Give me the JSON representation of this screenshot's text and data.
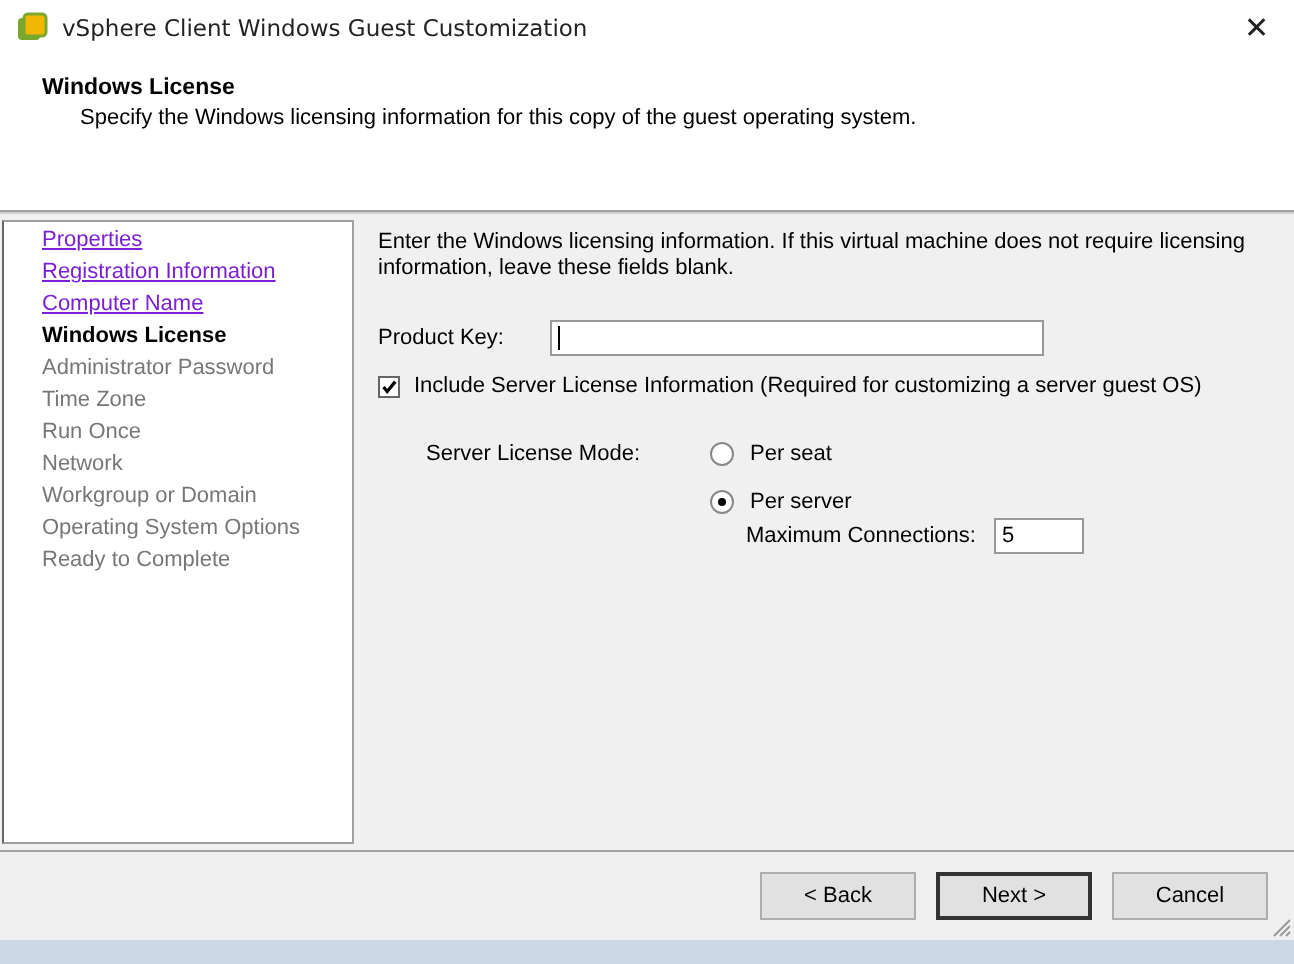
{
  "window": {
    "title": "vSphere Client Windows Guest Customization",
    "close": "✕"
  },
  "header": {
    "title": "Windows License",
    "subtitle": "Specify the Windows licensing information for this copy of the guest operating system."
  },
  "sidebar": {
    "items": [
      {
        "label": "Properties",
        "kind": "done"
      },
      {
        "label": "Registration Information",
        "kind": "done"
      },
      {
        "label": "Computer Name",
        "kind": "done"
      },
      {
        "label": "Windows License",
        "kind": "current"
      },
      {
        "label": "Administrator Password",
        "kind": "pending"
      },
      {
        "label": "Time Zone",
        "kind": "pending"
      },
      {
        "label": "Run Once",
        "kind": "pending"
      },
      {
        "label": "Network",
        "kind": "pending"
      },
      {
        "label": "Workgroup or Domain",
        "kind": "pending"
      },
      {
        "label": "Operating System Options",
        "kind": "pending"
      },
      {
        "label": "Ready to Complete",
        "kind": "pending"
      }
    ]
  },
  "content": {
    "intro": "Enter the Windows licensing information. If this virtual machine does not require licensing information, leave these fields blank.",
    "product_key": {
      "label": "Product Key:"
    },
    "include_server": {
      "label": "Include Server License Information (Required for customizing a server guest OS)",
      "checked": true
    },
    "mode_label": "Server License Mode:",
    "modes": [
      {
        "label": "Per seat",
        "selected": false
      },
      {
        "label": "Per server",
        "selected": true
      }
    ],
    "max_connections": {
      "label": "Maximum Connections:",
      "value": "5"
    }
  },
  "buttons": [
    {
      "label": "< Back",
      "default": false
    },
    {
      "label": "Next >",
      "default": true
    },
    {
      "label": "Cancel",
      "default": false
    }
  ]
}
